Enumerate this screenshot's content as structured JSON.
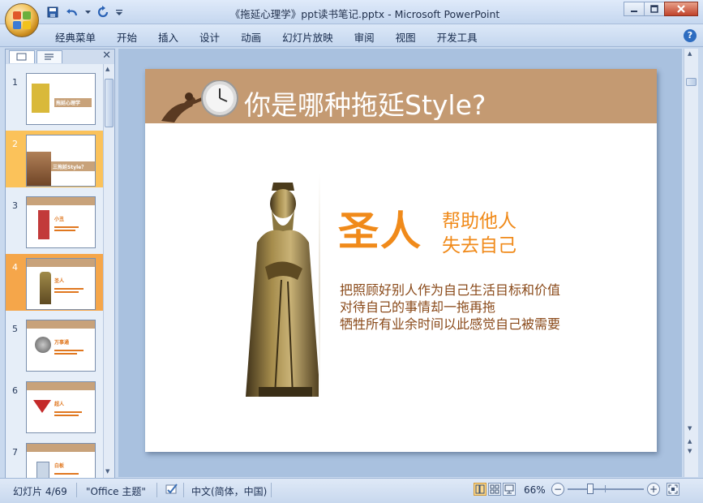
{
  "window": {
    "title": "《拖延心理学》ppt读书笔记.pptx - Microsoft PowerPoint"
  },
  "ribbon": {
    "tabs": [
      "经典菜单",
      "开始",
      "插入",
      "设计",
      "动画",
      "幻灯片放映",
      "审阅",
      "视图",
      "开发工具"
    ]
  },
  "thumbnails": [
    {
      "num": "1",
      "label": "拖延心理学"
    },
    {
      "num": "2",
      "label": "三拖延Style？"
    },
    {
      "num": "3",
      "label": "小丑"
    },
    {
      "num": "4",
      "label": "圣人"
    },
    {
      "num": "5",
      "label": "万事通"
    },
    {
      "num": "6",
      "label": "超人"
    },
    {
      "num": "7",
      "label": "白板"
    }
  ],
  "slide": {
    "title": "你是哪种拖延Style?",
    "heading": "圣人",
    "sub1": "帮助他人",
    "sub2": "失去自己",
    "body": [
      "把照顾好别人作为自己生活目标和价值",
      "对待自己的事情却一拖再拖",
      "牺牲所有业余时间以此感觉自己被需要"
    ]
  },
  "status": {
    "slide_indicator": "幻灯片 4/69",
    "theme": "\"Office 主题\"",
    "language": "中文(简体，中国)",
    "zoom": "66%",
    "zoom_level": 0.3
  },
  "colors": {
    "accent_orange": "#f08a1a",
    "banner": "#c49a72",
    "body_brown": "#8a4a1a"
  }
}
